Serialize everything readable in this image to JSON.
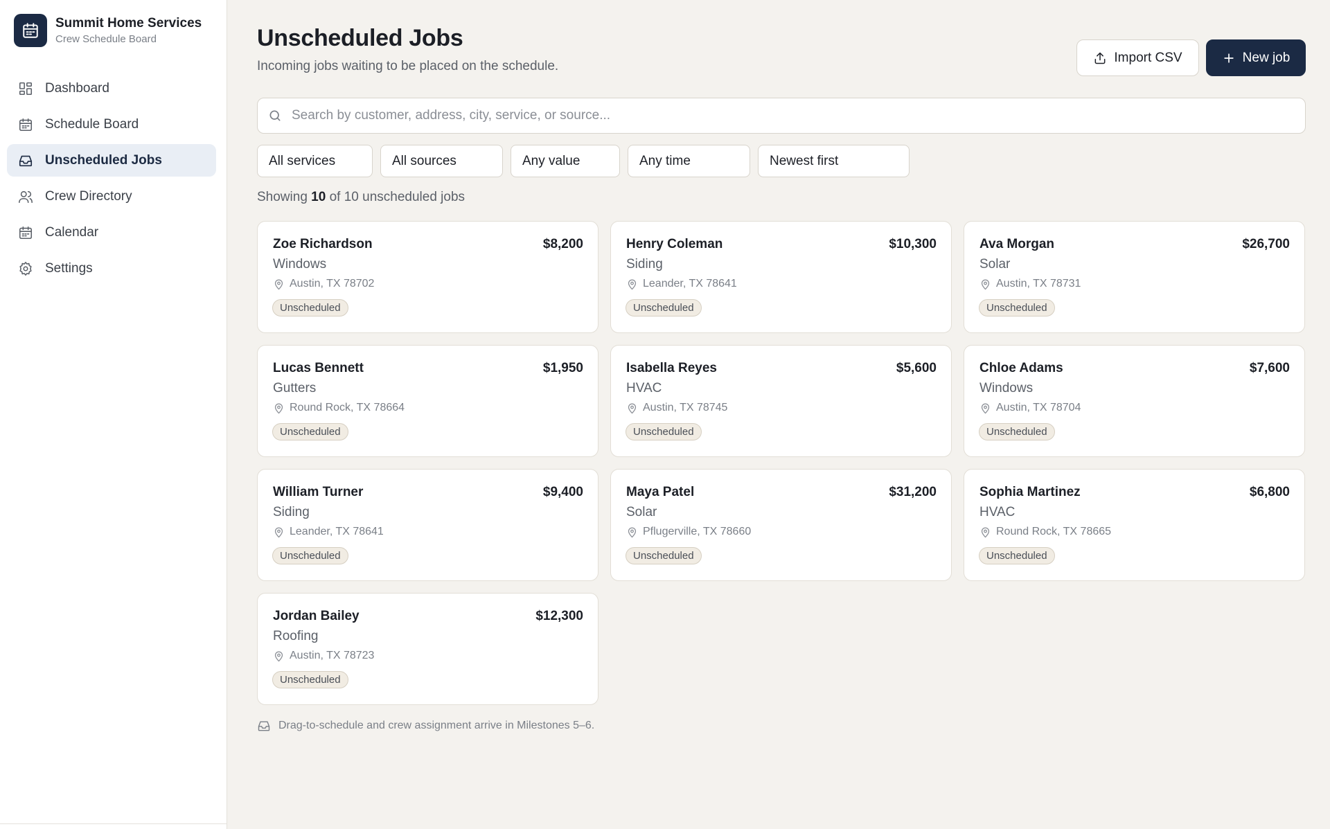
{
  "brand": {
    "name": "Summit Home Services",
    "subtitle": "Crew Schedule Board",
    "icon": "calendar-icon"
  },
  "nav": {
    "items": [
      {
        "label": "Dashboard",
        "icon": "dashboard-icon",
        "active": false
      },
      {
        "label": "Schedule Board",
        "icon": "calendar-icon",
        "active": false
      },
      {
        "label": "Unscheduled Jobs",
        "icon": "inbox-icon",
        "active": true
      },
      {
        "label": "Crew Directory",
        "icon": "users-icon",
        "active": false
      },
      {
        "label": "Calendar",
        "icon": "calendar-icon",
        "active": false
      },
      {
        "label": "Settings",
        "icon": "gear-icon",
        "active": false
      }
    ]
  },
  "header": {
    "title": "Unscheduled Jobs",
    "subtitle": "Incoming jobs waiting to be placed on the schedule.",
    "import_label": "Import CSV",
    "new_label": "New job"
  },
  "search": {
    "placeholder": "Search by customer, address, city, service, or source...",
    "value": ""
  },
  "filters": {
    "service": "All services",
    "source": "All sources",
    "value": "Any value",
    "time": "Any time",
    "sort": "Newest first"
  },
  "count": {
    "prefix": "Showing",
    "shown": "10",
    "middle": "of 10 unscheduled jobs"
  },
  "jobs": [
    {
      "name": "Zoe Richardson",
      "value": "$8,200",
      "service": "Windows",
      "location": "Austin, TX 78702",
      "status": "Unscheduled"
    },
    {
      "name": "Henry Coleman",
      "value": "$10,300",
      "service": "Siding",
      "location": "Leander, TX 78641",
      "status": "Unscheduled"
    },
    {
      "name": "Ava Morgan",
      "value": "$26,700",
      "service": "Solar",
      "location": "Austin, TX 78731",
      "status": "Unscheduled"
    },
    {
      "name": "Lucas Bennett",
      "value": "$1,950",
      "service": "Gutters",
      "location": "Round Rock, TX 78664",
      "status": "Unscheduled"
    },
    {
      "name": "Isabella Reyes",
      "value": "$5,600",
      "service": "HVAC",
      "location": "Austin, TX 78745",
      "status": "Unscheduled"
    },
    {
      "name": "Chloe Adams",
      "value": "$7,600",
      "service": "Windows",
      "location": "Austin, TX 78704",
      "status": "Unscheduled"
    },
    {
      "name": "William Turner",
      "value": "$9,400",
      "service": "Siding",
      "location": "Leander, TX 78641",
      "status": "Unscheduled"
    },
    {
      "name": "Maya Patel",
      "value": "$31,200",
      "service": "Solar",
      "location": "Pflugerville, TX 78660",
      "status": "Unscheduled"
    },
    {
      "name": "Sophia Martinez",
      "value": "$6,800",
      "service": "HVAC",
      "location": "Round Rock, TX 78665",
      "status": "Unscheduled"
    },
    {
      "name": "Jordan Bailey",
      "value": "$12,300",
      "service": "Roofing",
      "location": "Austin, TX 78723",
      "status": "Unscheduled"
    }
  ],
  "footer_note": "Drag-to-schedule and crew assignment arrive in Milestones 5–6.",
  "colors": {
    "brand_navy": "#1b2a44",
    "active_nav_bg": "#e9eef5",
    "page_bg": "#f4f2ee",
    "badge_bg": "#f1ece3"
  }
}
